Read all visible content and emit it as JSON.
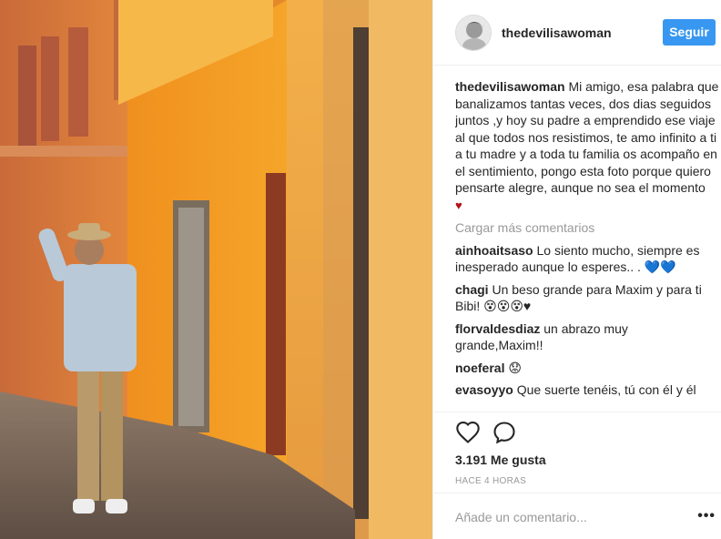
{
  "post": {
    "author": "thedevilisawoman",
    "follow_label": "Seguir",
    "caption_user": "thedevilisawoman",
    "caption_text": "Mi amigo, esa palabra que banalizamos tantas veces, dos dias seguidos juntos ,y hoy su padre a emprendido ese viaje al que todos nos resistimos, te amo infinito a ti a tu madre y a toda tu familia os acompaño en el sentimiento, pongo esta foto porque quiero pensarte alegre, aunque no sea el momento",
    "caption_emoji": "♥",
    "load_more": "Cargar más comentarios",
    "likes": "3.191 Me gusta",
    "time": "HACE 4 HORAS",
    "comment_placeholder": "Añade un comentario...",
    "more_label": "•••"
  },
  "comments": [
    {
      "user": "ainhoaitsaso",
      "text": "Lo siento mucho, siempre es inesperado aunque lo esperes.. .",
      "emoji": "💙💙"
    },
    {
      "user": "chagi",
      "text": "Un beso grande para Maxim y para ti Bibi!",
      "emoji": "😵😵😵♥"
    },
    {
      "user": "florvaldesdiaz",
      "text": "un abrazo muy grande,Maxim!!",
      "emoji": ""
    },
    {
      "user": "noeferal",
      "text": "",
      "emoji": "😟"
    },
    {
      "user": "evasoyyo",
      "text": "Que suerte tenéis, tú con él y él",
      "emoji": ""
    }
  ],
  "icons": {
    "like": "heart-outline-icon",
    "comment": "speech-bubble-icon",
    "more": "ellipsis-icon"
  },
  "colors": {
    "accent": "#3897f0",
    "text": "#262626",
    "muted": "#999999",
    "heart": "#b5121b"
  }
}
